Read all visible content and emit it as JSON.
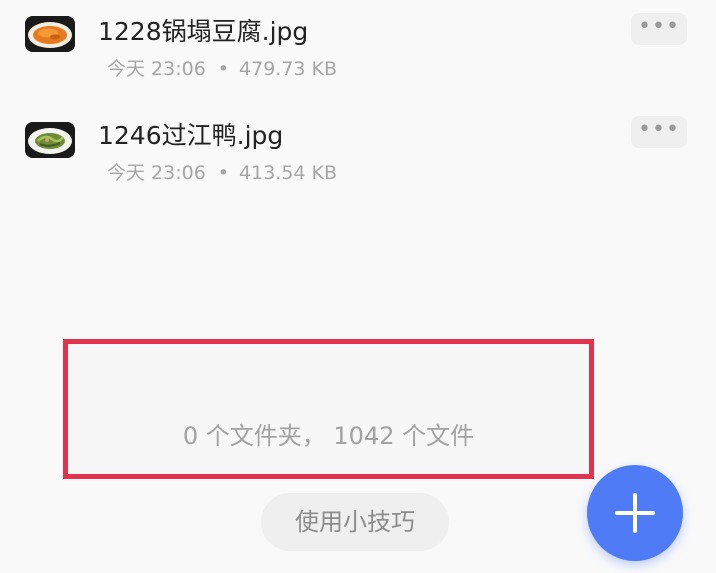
{
  "files": [
    {
      "name": "1228锅塌豆腐.jpg",
      "date": "今天 23:06",
      "separator": "•",
      "size": "479.73 KB",
      "thumbnail_icon": "fried-tofu-thumbnail",
      "more_label": "•••"
    },
    {
      "name": "1246过江鸭.jpg",
      "date": "今天 23:06",
      "separator": "•",
      "size": "413.54 KB",
      "thumbnail_icon": "duck-dish-thumbnail",
      "more_label": "•••"
    }
  ],
  "summary": {
    "text": "0 个文件夹， 1042 个文件",
    "highlight_color": "#e2334e"
  },
  "tips_button": {
    "label": "使用小技巧"
  },
  "fab": {
    "icon": "plus-icon",
    "color": "#4f7cf6"
  }
}
